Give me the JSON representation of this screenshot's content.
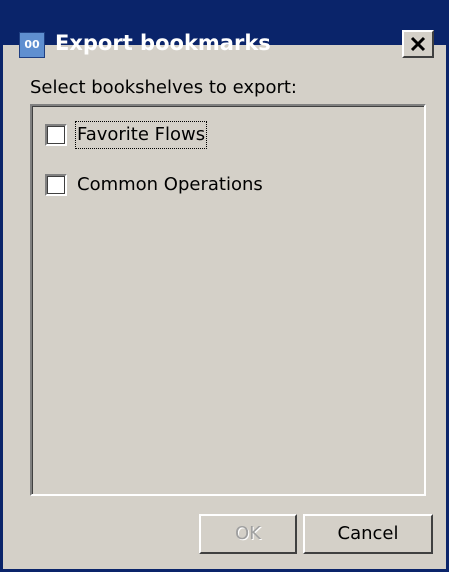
{
  "window": {
    "icon_text": "00",
    "title": "Export bookmarks",
    "close_icon": "close-x-icon"
  },
  "prompt": "Select bookshelves to export:",
  "bookshelves": [
    {
      "label": "Favorite Flows",
      "checked": false,
      "focused": true
    },
    {
      "label": "Common Operations",
      "checked": false,
      "focused": false
    }
  ],
  "buttons": {
    "ok_label": "OK",
    "ok_enabled": false,
    "cancel_label": "Cancel"
  },
  "colors": {
    "titlebar": "#0a246a",
    "face": "#d4d0c8",
    "disabled_text": "#a0a0a0"
  }
}
